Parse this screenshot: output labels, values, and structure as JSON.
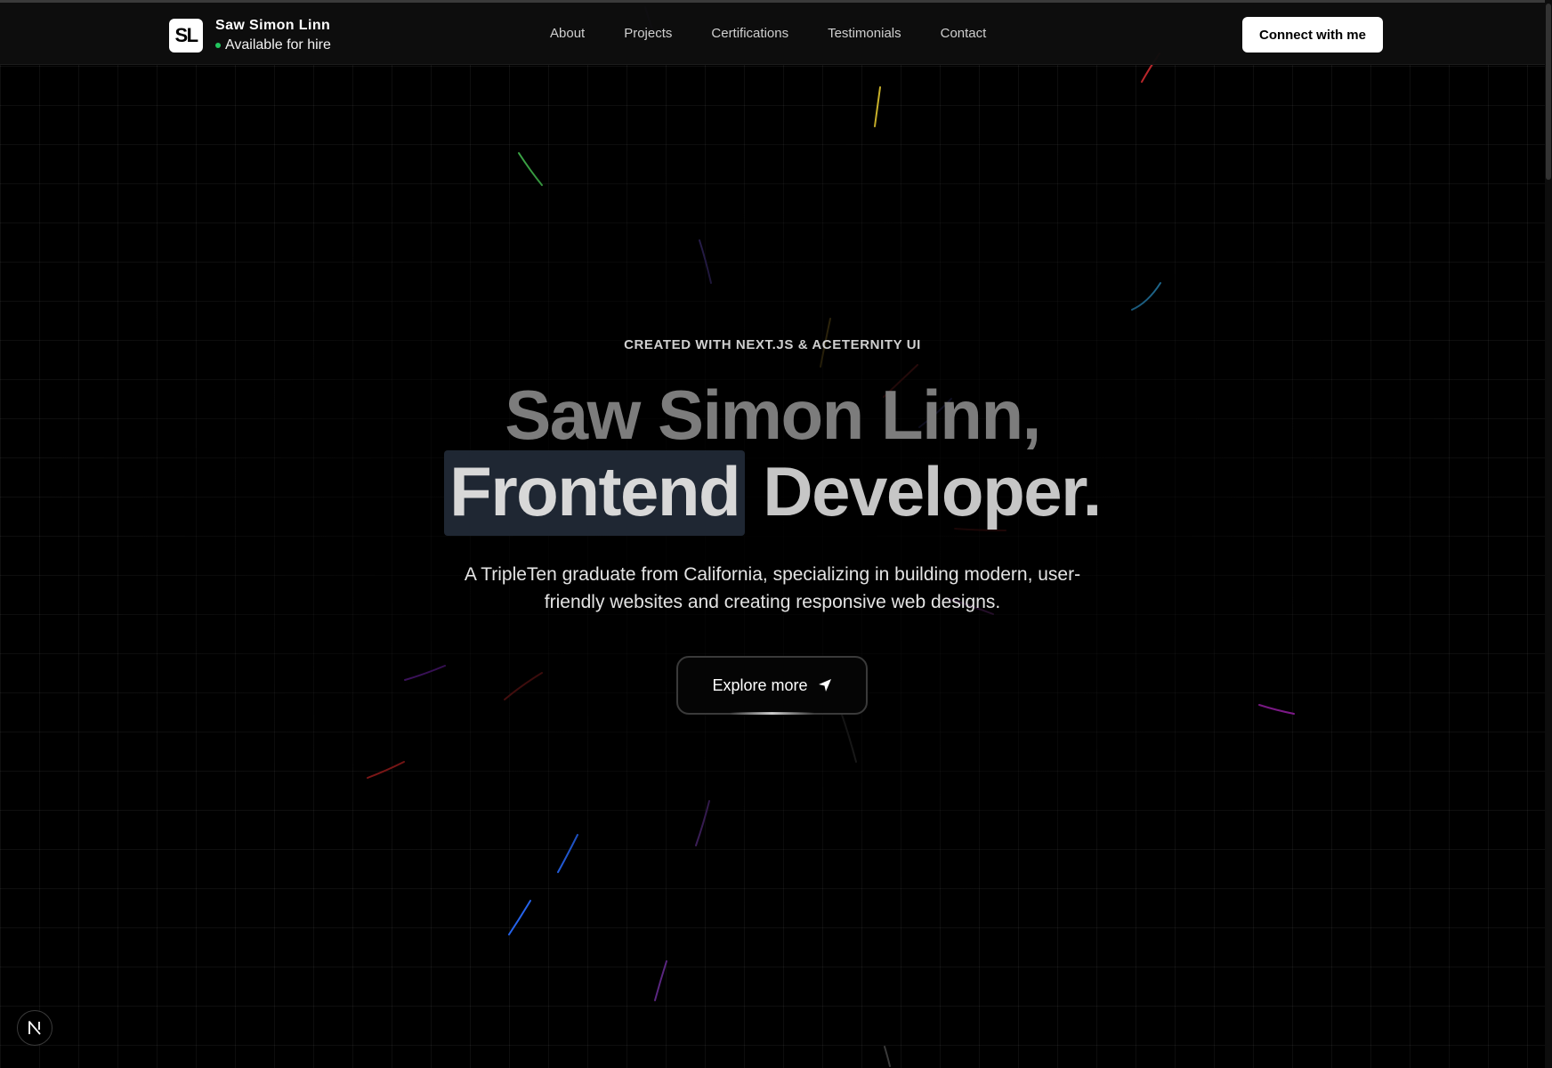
{
  "header": {
    "logo_text": "SL",
    "brand_name": "Saw Simon Linn",
    "status": "Available for hire",
    "status_color": "#22c55e",
    "nav": [
      {
        "label": "About"
      },
      {
        "label": "Projects"
      },
      {
        "label": "Certifications"
      },
      {
        "label": "Testimonials"
      },
      {
        "label": "Contact"
      }
    ],
    "cta_label": "Connect with me"
  },
  "hero": {
    "eyebrow": "CREATED WITH NEXT.JS & ACETERNITY UI",
    "headline_line1": "Saw Simon Linn,",
    "headline_highlight": "Frontend",
    "headline_rest": "Developer.",
    "subtitle": "A TripleTen graduate from California, specializing in building modern, user-friendly websites and creating responsive web designs.",
    "button_label": "Explore more",
    "button_icon": "paper-plane-icon"
  },
  "footer_badge": {
    "icon": "nextjs-logo-icon"
  },
  "colors": {
    "background": "#000000",
    "highlight_bg": "#1f2733",
    "cta_bg": "#ffffff",
    "streaks": [
      "#22c55e",
      "#eab308",
      "#ef4444",
      "#3b82f6",
      "#a855f7",
      "#38bdf8"
    ]
  }
}
